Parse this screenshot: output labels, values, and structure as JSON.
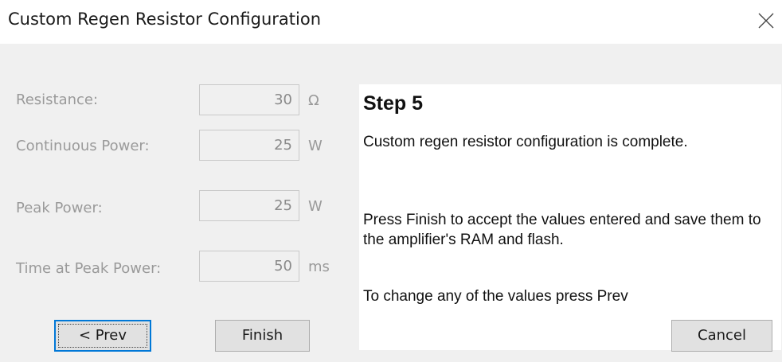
{
  "window": {
    "title": "Custom Regen Resistor Configuration",
    "close_icon": "close-icon"
  },
  "fields": [
    {
      "label": "Resistance:",
      "value": "30",
      "unit": "Ω"
    },
    {
      "label": "Continuous Power:",
      "value": "25",
      "unit": "W"
    },
    {
      "label": "Peak Power:",
      "value": "25",
      "unit": "W"
    },
    {
      "label": "Time at Peak Power:",
      "value": "50",
      "unit": "ms"
    }
  ],
  "info": {
    "title": "Step 5",
    "paragraphs": [
      "Custom regen resistor configuration is complete.",
      "Press Finish to accept the values entered and save them to the amplifier's RAM and flash.",
      "To change any of the values press Prev"
    ]
  },
  "buttons": {
    "prev": "< Prev",
    "finish": "Finish",
    "cancel": "Cancel"
  },
  "colors": {
    "default_button_border": "#0078d7",
    "disabled_text": "#9a9a9a"
  }
}
